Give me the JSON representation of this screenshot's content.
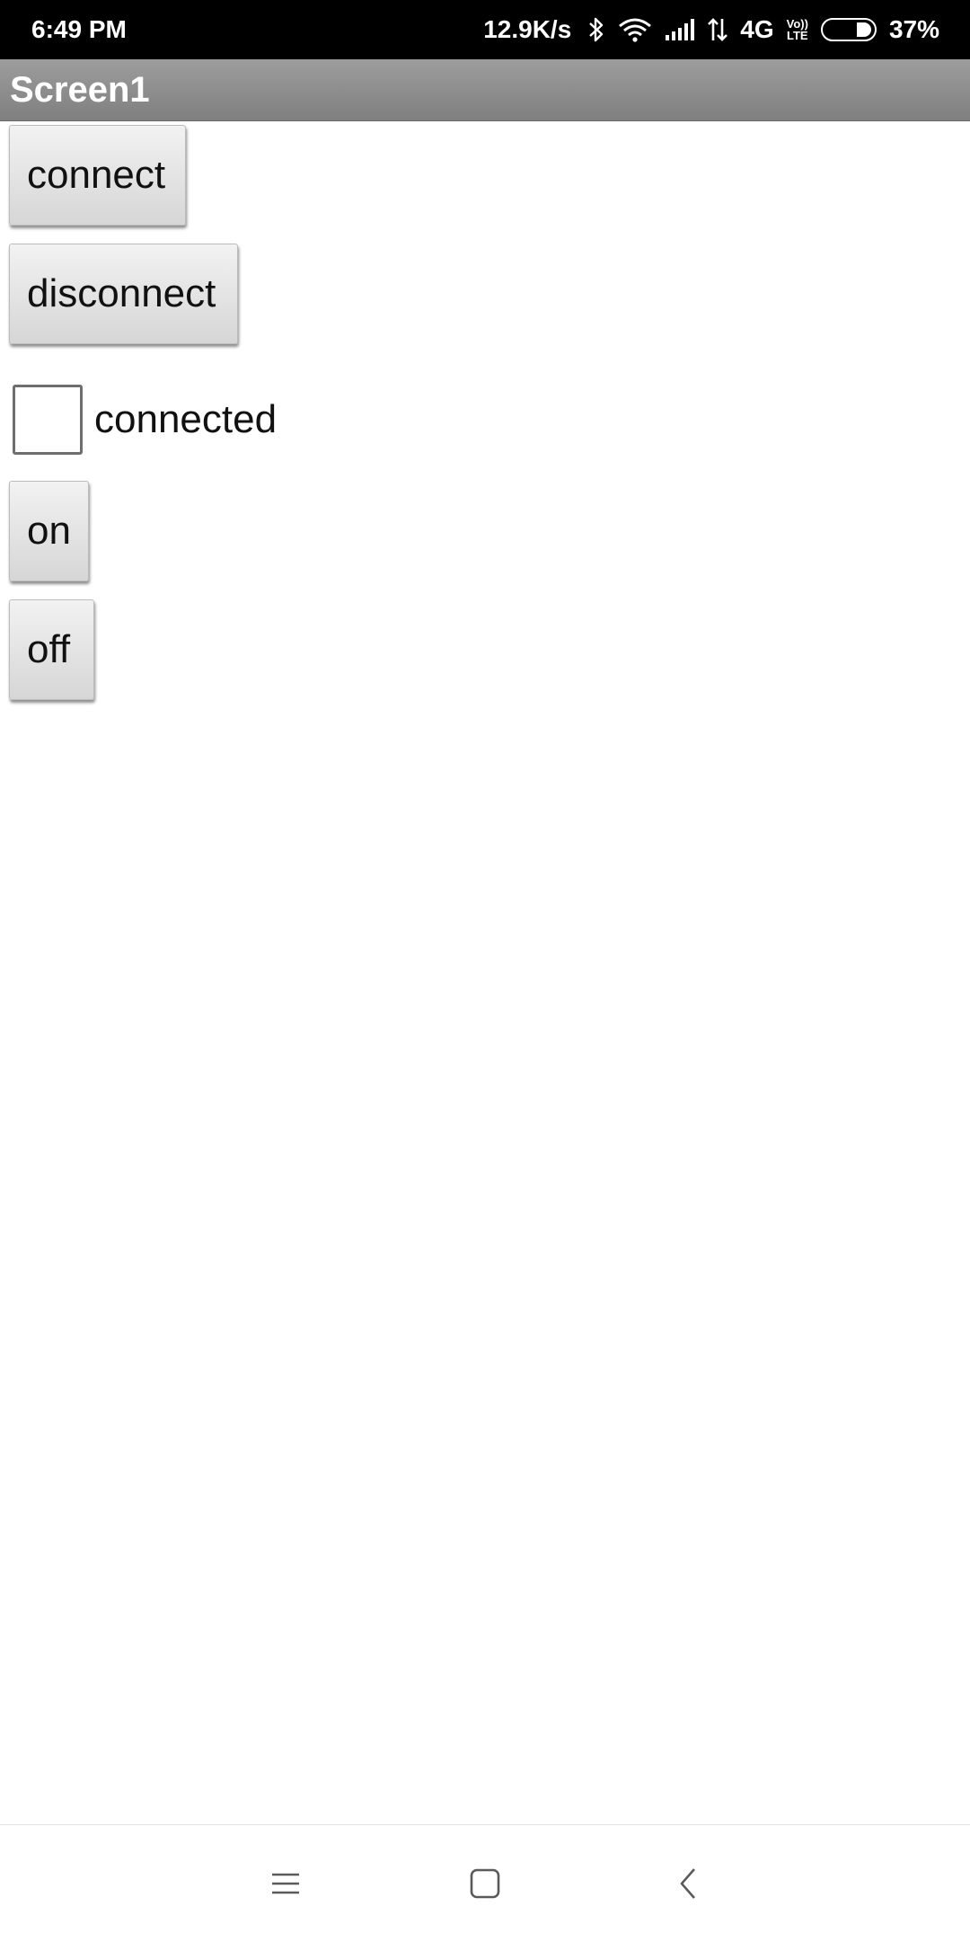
{
  "status_bar": {
    "time": "6:49 PM",
    "net_speed": "12.9K/s",
    "network_type": "4G",
    "volte_top": "Vo))",
    "volte_bottom": "LTE",
    "battery": "37%",
    "icons": [
      "bluetooth-icon",
      "wifi-icon",
      "signal-icon",
      "data-arrows-icon",
      "volte-icon",
      "battery-icon"
    ]
  },
  "title_bar": {
    "title": "Screen1"
  },
  "main": {
    "connect_label": "connect",
    "disconnect_label": "disconnect",
    "checkbox": {
      "label": "connected",
      "checked": false
    },
    "on_label": "on",
    "off_label": "off"
  },
  "nav_bar": {
    "icons": [
      "menu-icon",
      "home-icon",
      "back-icon"
    ]
  },
  "colors": {
    "status_bar_bg": "#000000",
    "title_bar_bg": "#8e8e8e",
    "button_bg": "#e3e3e3",
    "page_bg": "#ffffff"
  }
}
